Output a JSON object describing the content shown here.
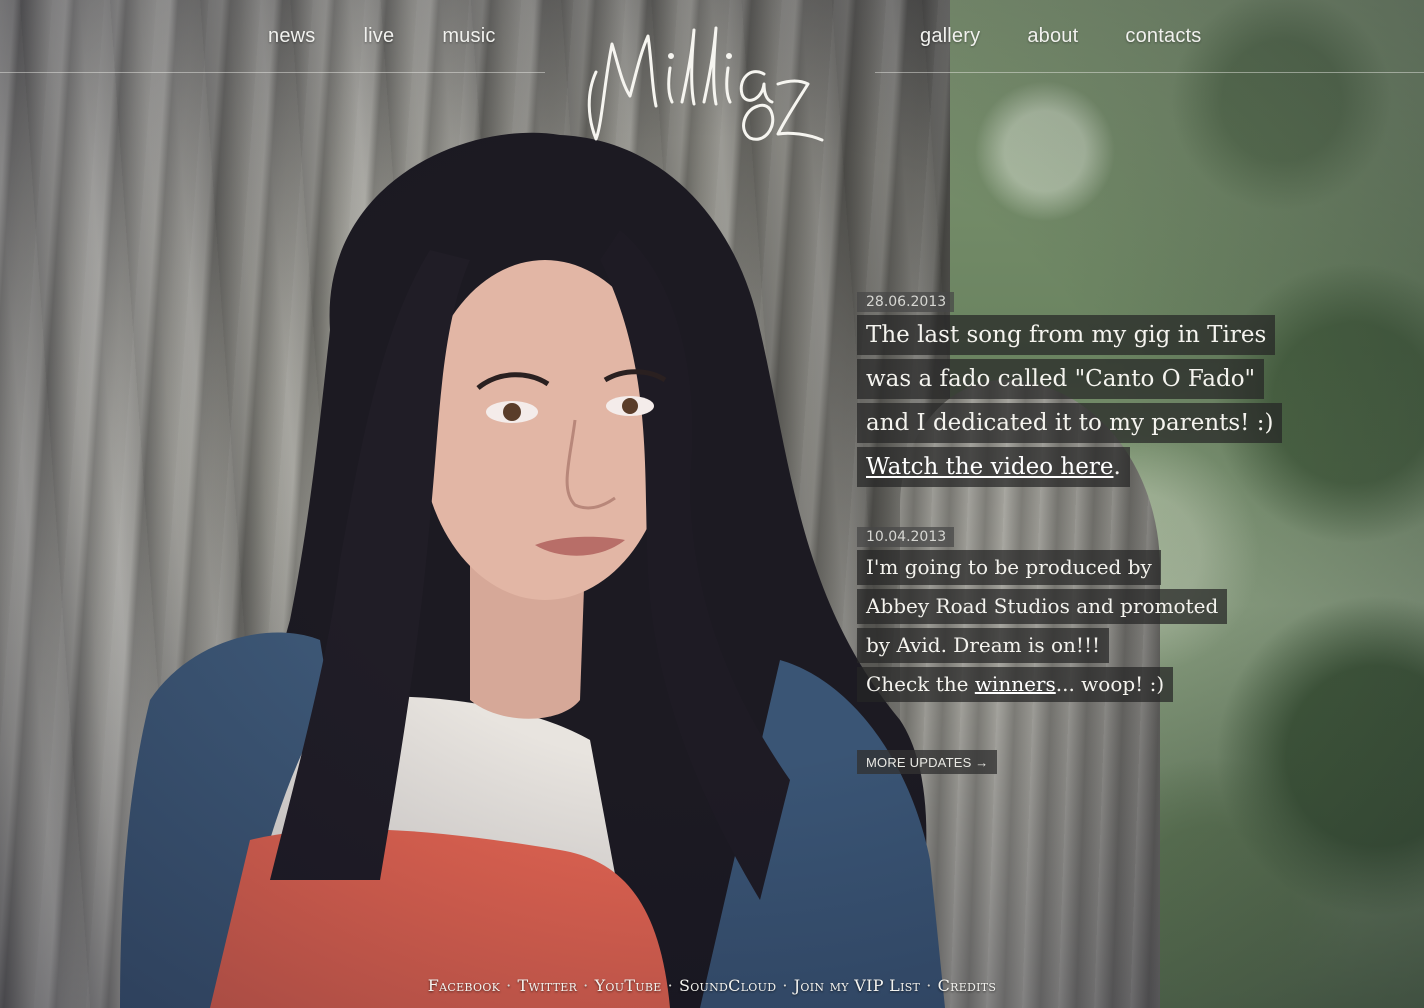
{
  "nav": {
    "left": [
      {
        "label": "news"
      },
      {
        "label": "live"
      },
      {
        "label": "music"
      }
    ],
    "right": [
      {
        "label": "gallery"
      },
      {
        "label": "about"
      },
      {
        "label": "contacts"
      }
    ]
  },
  "logo": {
    "text": "Millia Oz"
  },
  "updates": {
    "posts": [
      {
        "date": "28.06.2013",
        "lines": [
          "The last song from my gig in Tires",
          "was a fado called \"Canto O Fado\"",
          "and I dedicated it to my parents! :)"
        ],
        "link_text": "Watch the video here",
        "link_suffix": "."
      },
      {
        "date": "10.04.2013",
        "lines": [
          "I'm going to be produced by",
          "Abbey Road Studios and promoted",
          "by Avid. Dream is on!!!"
        ],
        "last_prefix": "Check the ",
        "link_text": "winners",
        "last_suffix": "... woop! :)"
      }
    ],
    "more_label": "MORE UPDATES →"
  },
  "footer": {
    "links": [
      "Facebook",
      "Twitter",
      "YouTube",
      "SoundCloud",
      "Join my VIP List",
      "Credits"
    ],
    "separator": "·"
  },
  "colors": {
    "text": "#f4f3ee",
    "panel": "#262626",
    "date_panel": "#464646"
  }
}
